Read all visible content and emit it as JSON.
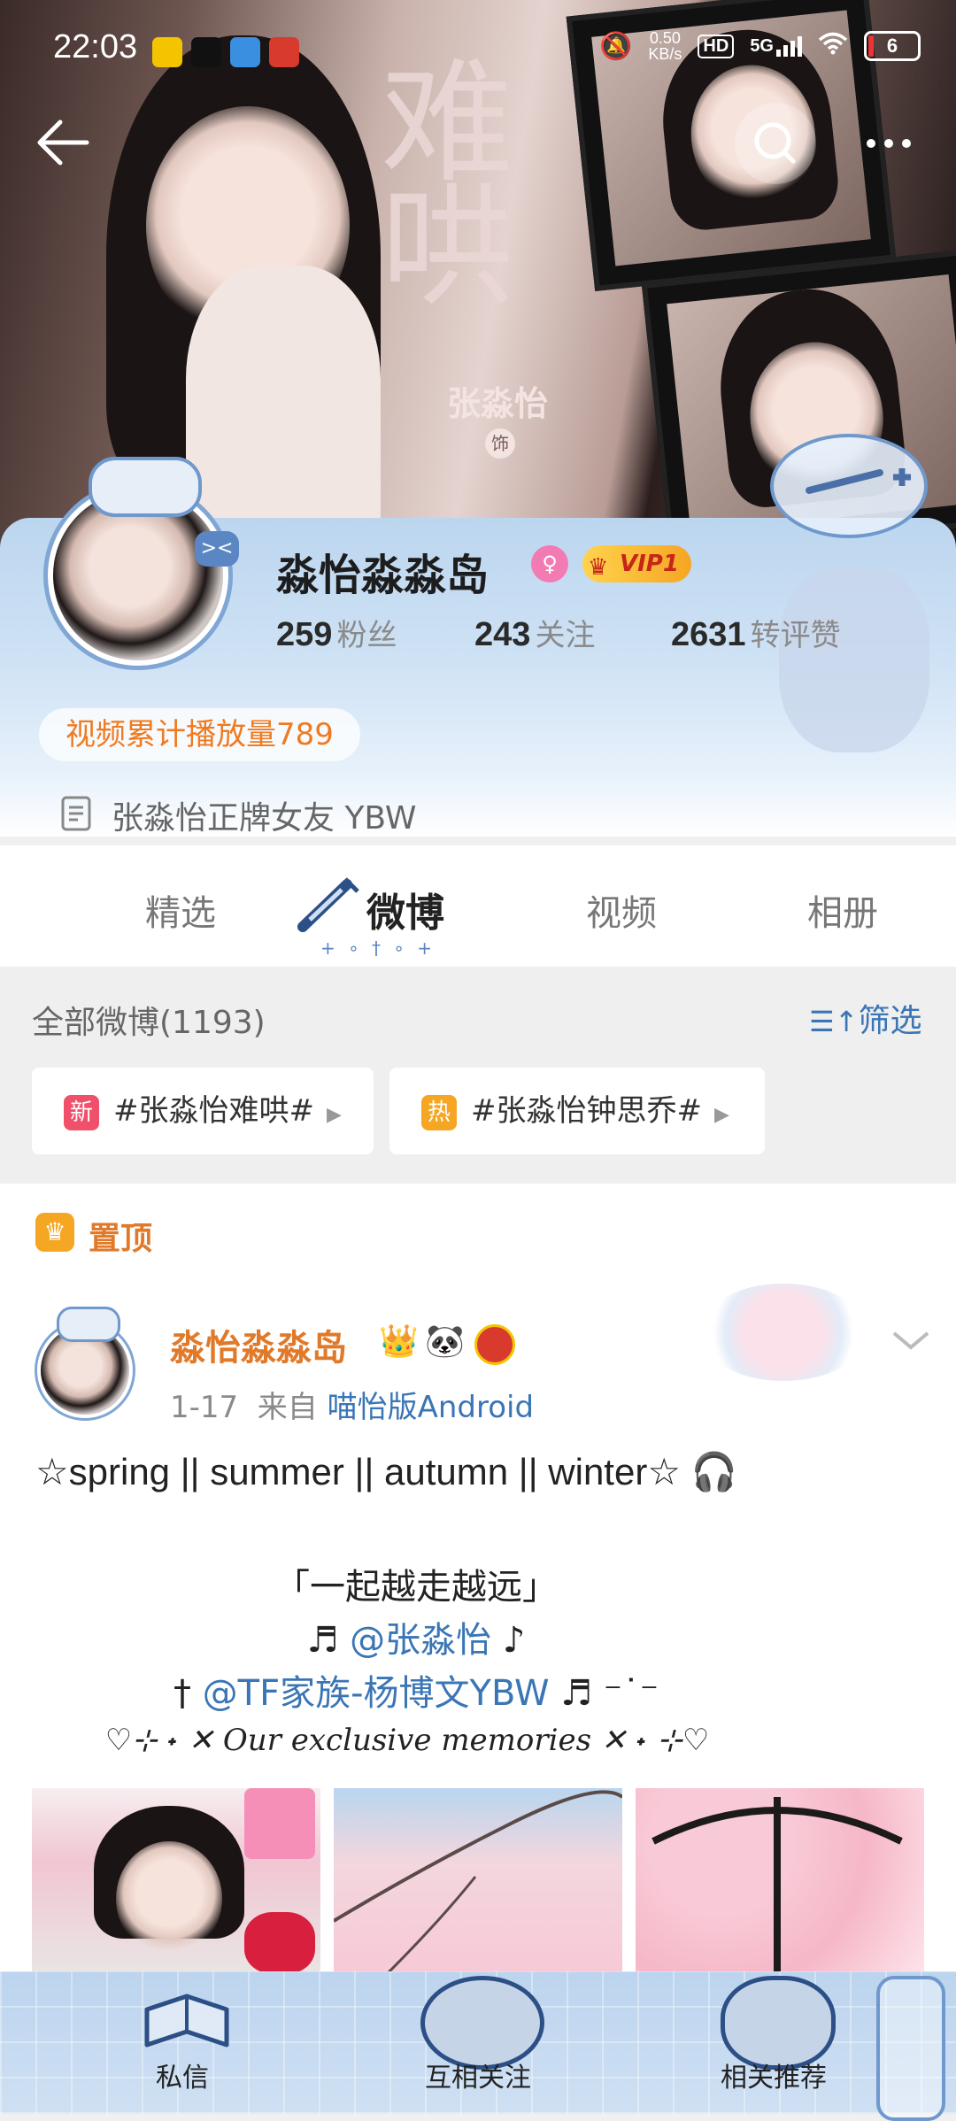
{
  "status_bar": {
    "time": "22:03",
    "net_speed_value": "0.50",
    "net_speed_unit": "KB/s",
    "hd_label": "HD",
    "network": "5G",
    "battery": "6"
  },
  "banner": {
    "title_calligraphy": "难哄",
    "actor_name": "张淼怡",
    "role_label": "饰"
  },
  "profile": {
    "nickname": "淼怡淼淼岛",
    "vip_label": "VIP1",
    "stats": [
      {
        "value": "259",
        "label": "粉丝"
      },
      {
        "value": "243",
        "label": "关注"
      },
      {
        "value": "2631",
        "label": "转评赞"
      }
    ],
    "video_play_count": "视频累计播放量789",
    "bio": "张淼怡正牌女友 YBW"
  },
  "tabs": {
    "items": [
      "精选",
      "微博",
      "视频",
      "相册"
    ],
    "active": "微博",
    "decoration": "+ ∘ † ∘ +"
  },
  "filter": {
    "total_label": "全部微博(1193)",
    "filter_label": "筛选",
    "chips": [
      {
        "badge": "新",
        "text": "#张淼怡难哄#",
        "color": "#f0506a"
      },
      {
        "badge": "热",
        "text": "#张淼怡钟思乔#",
        "color": "#f5a623"
      }
    ]
  },
  "pinned": {
    "label": "置顶"
  },
  "post": {
    "author": "淼怡淼淼岛",
    "date": "1-17",
    "source_prefix": "来自",
    "source": "喵怡版Android",
    "line1": "☆spring ||  summer ||  autumn ||  winter☆",
    "line2": "「一起越走越远」",
    "line3_prefix": "♬ ",
    "line3_mention": "@张淼怡",
    "line3_suffix": " ♪",
    "line4_prefix": "† ",
    "line4_mention": "@TF家族-杨博文YBW",
    "line4_suffix": " ♬ ⁻˙⁻",
    "line5": "♡⊹ ˖ ✕ Our exclusive memories ✕ ˖ ⊹♡"
  },
  "bottom_bar": {
    "items": [
      "私信",
      "互相关注",
      "相关推荐"
    ]
  },
  "colors": {
    "accent_orange": "#e07a2a",
    "link_blue": "#3a75b5",
    "vip_gold": "#f5b400"
  }
}
